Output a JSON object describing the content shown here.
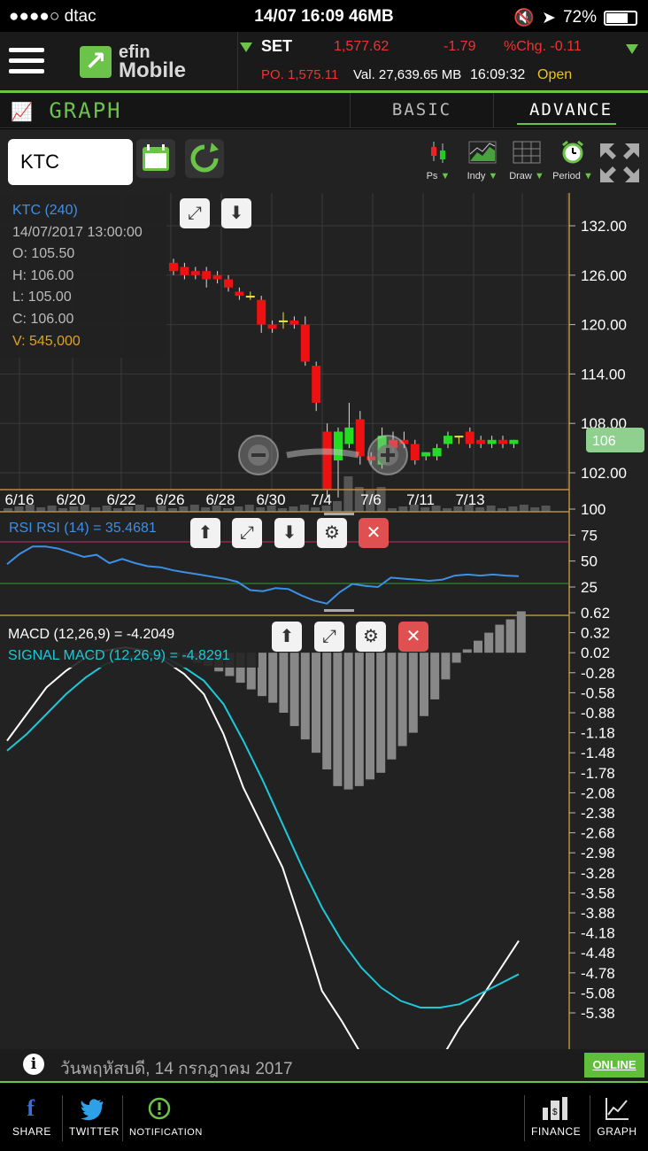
{
  "status": {
    "carrier": "●●●●○ dtac",
    "center": "14/07 16:09 46MB",
    "battery": "72%"
  },
  "ticker": {
    "market": "SET",
    "value": "1,577.62",
    "change": "-1.79",
    "pct": "%Chg. -0.11",
    "po": "PO. 1,575.11",
    "val": "Val. 27,639.65 MB",
    "time": "16:09:32",
    "state": "Open"
  },
  "logo": {
    "line1": "efin",
    "line2": "Mobile"
  },
  "tabs": {
    "graph": "GRAPH",
    "basic": "BASIC",
    "advance": "ADVANCE"
  },
  "toolbar": {
    "symbol": "KTC",
    "tools": [
      {
        "label": "Ps"
      },
      {
        "label": "Indy"
      },
      {
        "label": "Draw"
      },
      {
        "label": "Period"
      }
    ]
  },
  "info": {
    "title": "KTC (240)",
    "datetime": "14/07/2017 13:00:00",
    "open": "O: 105.50",
    "high": "H: 106.00",
    "low": "L: 105.00",
    "close": "C: 106.00",
    "volume": "V: 545,000"
  },
  "rsi_label": "RSI RSI (14) = 35.4681",
  "macd_label": "MACD (12,26,9) = -4.2049",
  "signal_label": "SIGNAL MACD (12,26,9) = -4.8291",
  "current_price": "106",
  "infobar": {
    "date": "วันพฤหัสบดี, 14 กรกฎาคม 2017",
    "online": "ONLINE"
  },
  "nav": {
    "share": "SHARE",
    "twitter": "TWITTER",
    "notification": "NOTIFICATION",
    "finance": "FINANCE",
    "graph": "GRAPH"
  },
  "colors": {
    "accent": "#6cc34a",
    "up": "#22dd22",
    "down": "#ee1111",
    "rsi": "#3d8fe6",
    "signal": "#1ec8d8"
  },
  "chart_data": [
    {
      "type": "candlestick",
      "title": "KTC (240)",
      "x_tick_labels": [
        "6/16",
        "6/20",
        "6/22",
        "6/26",
        "6/28",
        "6/30",
        "7/4",
        "7/6",
        "7/11",
        "7/13"
      ],
      "y_ticks": [
        "132.00",
        "126.00",
        "120.00",
        "114.00",
        "108.00",
        "102.00"
      ],
      "ylim": [
        100,
        134
      ],
      "candles": [
        {
          "o": 127.5,
          "h": 128.0,
          "c": 126.5,
          "l": 126.0
        },
        {
          "o": 127.0,
          "h": 127.5,
          "c": 126.0,
          "l": 125.5
        },
        {
          "o": 126.5,
          "h": 127.0,
          "c": 126.0,
          "l": 125.5
        },
        {
          "o": 126.5,
          "h": 127.0,
          "c": 125.5,
          "l": 124.5
        },
        {
          "o": 126.0,
          "h": 126.5,
          "c": 125.5,
          "l": 125.0
        },
        {
          "o": 125.5,
          "h": 126.0,
          "c": 124.5,
          "l": 124.0
        },
        {
          "o": 124.0,
          "h": 124.5,
          "c": 123.5,
          "l": 123.0
        },
        {
          "o": 123.5,
          "h": 124.0,
          "c": 123.5,
          "l": 123.0
        },
        {
          "o": 123.0,
          "h": 123.5,
          "c": 120.0,
          "l": 119.0
        },
        {
          "o": 120.0,
          "h": 120.5,
          "c": 119.5,
          "l": 119.0
        },
        {
          "o": 120.5,
          "h": 121.5,
          "c": 120.5,
          "l": 119.5
        },
        {
          "o": 120.5,
          "h": 121.0,
          "c": 120.0,
          "l": 119.5
        },
        {
          "o": 120.0,
          "h": 121.0,
          "c": 115.5,
          "l": 115.0
        },
        {
          "o": 115.0,
          "h": 115.5,
          "c": 110.5,
          "l": 109.5
        },
        {
          "o": 107.0,
          "h": 108.0,
          "c": 100.0,
          "l": 99.0
        },
        {
          "o": 103.5,
          "h": 107.5,
          "c": 107.0,
          "l": 99.0
        },
        {
          "o": 105.5,
          "h": 110.5,
          "c": 107.5,
          "l": 105.0
        },
        {
          "o": 108.5,
          "h": 109.5,
          "c": 104.0,
          "l": 103.0
        },
        {
          "o": 104.0,
          "h": 104.5,
          "c": 103.5,
          "l": 103.0
        },
        {
          "o": 103.0,
          "h": 107.5,
          "c": 106.5,
          "l": 102.5
        },
        {
          "o": 106.0,
          "h": 107.0,
          "c": 105.0,
          "l": 104.5
        },
        {
          "o": 106.0,
          "h": 107.0,
          "c": 105.5,
          "l": 105.0
        },
        {
          "o": 105.5,
          "h": 106.0,
          "c": 103.5,
          "l": 103.0
        },
        {
          "o": 104.0,
          "h": 104.5,
          "c": 104.5,
          "l": 103.5
        },
        {
          "o": 104.0,
          "h": 105.5,
          "c": 105.0,
          "l": 103.5
        },
        {
          "o": 105.5,
          "h": 107.0,
          "c": 106.5,
          "l": 105.0
        },
        {
          "o": 106.5,
          "h": 106.5,
          "c": 106.5,
          "l": 105.5
        },
        {
          "o": 107.0,
          "h": 107.5,
          "c": 105.5,
          "l": 105.0
        },
        {
          "o": 106.0,
          "h": 106.5,
          "c": 105.5,
          "l": 105.0
        },
        {
          "o": 105.5,
          "h": 106.5,
          "c": 106.0,
          "l": 105.0
        },
        {
          "o": 106.0,
          "h": 106.5,
          "c": 105.5,
          "l": 105.0
        },
        {
          "o": 105.5,
          "h": 106.0,
          "c": 106.0,
          "l": 105.0
        }
      ]
    },
    {
      "type": "line",
      "title": "RSI RSI (14) = 35.4681",
      "y_ticks": [
        "100",
        "75",
        "50",
        "25"
      ],
      "ylim": [
        0,
        100
      ],
      "overbought": 70,
      "oversold": 30,
      "values": [
        47,
        57,
        64,
        64,
        62,
        58,
        54,
        56,
        48,
        52,
        48,
        45,
        44,
        41,
        39,
        37,
        35,
        33,
        30,
        22,
        21,
        24,
        23,
        17,
        12,
        9,
        20,
        28,
        26,
        25,
        34,
        33,
        32,
        31,
        32,
        36,
        37,
        36,
        37,
        36,
        35.5
      ]
    },
    {
      "type": "line+bar",
      "title": "MACD",
      "y_ticks": [
        "0.62",
        "0.32",
        "0.02",
        "-0.28",
        "-0.58",
        "-0.88",
        "-1.18",
        "-1.48",
        "-1.78",
        "-2.08",
        "-2.38",
        "-2.68",
        "-2.98",
        "-3.28",
        "-3.58",
        "-3.88",
        "-4.18",
        "-4.48",
        "-4.78",
        "-5.08",
        "-5.38"
      ],
      "ylim": [
        -5.9,
        0.62
      ],
      "macd": [
        -1.3,
        -0.9,
        -0.5,
        -0.25,
        -0.05,
        0.05,
        0.1,
        0.05,
        -0.1,
        -0.3,
        -0.6,
        -1.2,
        -2.0,
        -2.6,
        -3.2,
        -4.1,
        -5.05,
        -5.5,
        -6.0,
        -6.2,
        -6.2,
        -6.15,
        -6.1,
        -5.6,
        -5.2,
        -4.75,
        -4.3
      ],
      "signal": [
        -1.45,
        -1.2,
        -0.9,
        -0.6,
        -0.35,
        -0.15,
        -0.05,
        0.0,
        -0.05,
        -0.2,
        -0.4,
        -0.75,
        -1.3,
        -1.9,
        -2.55,
        -3.2,
        -3.8,
        -4.3,
        -4.7,
        -5.0,
        -5.2,
        -5.3,
        -5.3,
        -5.25,
        -5.1,
        -4.95,
        -4.8
      ],
      "histogram": [
        0,
        0,
        0,
        0,
        0,
        0,
        0,
        -0.05,
        -0.1,
        -0.15,
        -0.2,
        -0.28,
        -0.35,
        -0.45,
        -0.55,
        -0.65,
        -0.75,
        -0.9,
        -1.1,
        -1.3,
        -1.5,
        -1.75,
        -2.0,
        -2.05,
        -2.0,
        -1.9,
        -1.8,
        -1.6,
        -1.4,
        -1.2,
        -0.95,
        -0.7,
        -0.4,
        -0.15,
        0.05,
        0.18,
        0.3,
        0.42,
        0.5,
        0.62
      ]
    }
  ]
}
